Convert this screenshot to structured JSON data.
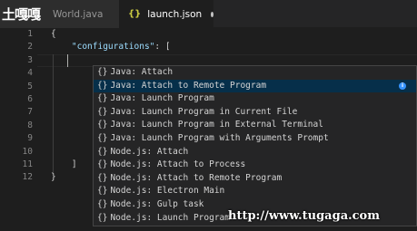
{
  "watermark_top": "土嘎嘎",
  "watermark_bottom": "http://www.tugaga.com",
  "tabs": [
    {
      "label": "World.java",
      "active": false
    },
    {
      "label": "launch.json",
      "active": true,
      "icon": "{}"
    }
  ],
  "line_numbers": [
    "1",
    "2",
    "3",
    "4",
    "5",
    "6",
    "7",
    "8",
    "9",
    "10",
    "11",
    "12"
  ],
  "code_lines": [
    {
      "text": "{"
    },
    {
      "indent": "    ",
      "key": "\"configurations\"",
      "rest": ": ["
    },
    {
      "text": ""
    },
    {
      "text": ""
    },
    {
      "text": ""
    },
    {
      "text": ""
    },
    {
      "text": ""
    },
    {
      "text": ""
    },
    {
      "text": ""
    },
    {
      "text": ""
    },
    {
      "text": "    ]"
    },
    {
      "text": "}"
    }
  ],
  "suggestions": [
    {
      "icon": "{}",
      "label": "Java: Attach"
    },
    {
      "icon": "{}",
      "label": "Java: Attach to Remote Program",
      "selected": true
    },
    {
      "icon": "{}",
      "label": "Java: Launch Program"
    },
    {
      "icon": "{}",
      "label": "Java: Launch Program in Current File"
    },
    {
      "icon": "{}",
      "label": "Java: Launch Program in External Terminal"
    },
    {
      "icon": "{}",
      "label": "Java: Launch Program with Arguments Prompt"
    },
    {
      "icon": "{}",
      "label": "Node.js: Attach"
    },
    {
      "icon": "{}",
      "label": "Node.js: Attach to Process"
    },
    {
      "icon": "{}",
      "label": "Node.js: Attach to Remote Program"
    },
    {
      "icon": "{}",
      "label": "Node.js: Electron Main"
    },
    {
      "icon": "{}",
      "label": "Node.js: Gulp task"
    },
    {
      "icon": "{}",
      "label": "Node.js: Launch Program"
    }
  ],
  "colors": {
    "selected_bg": "#062f4a",
    "info": "#3794ff",
    "json_icon": "#cbcb41"
  }
}
